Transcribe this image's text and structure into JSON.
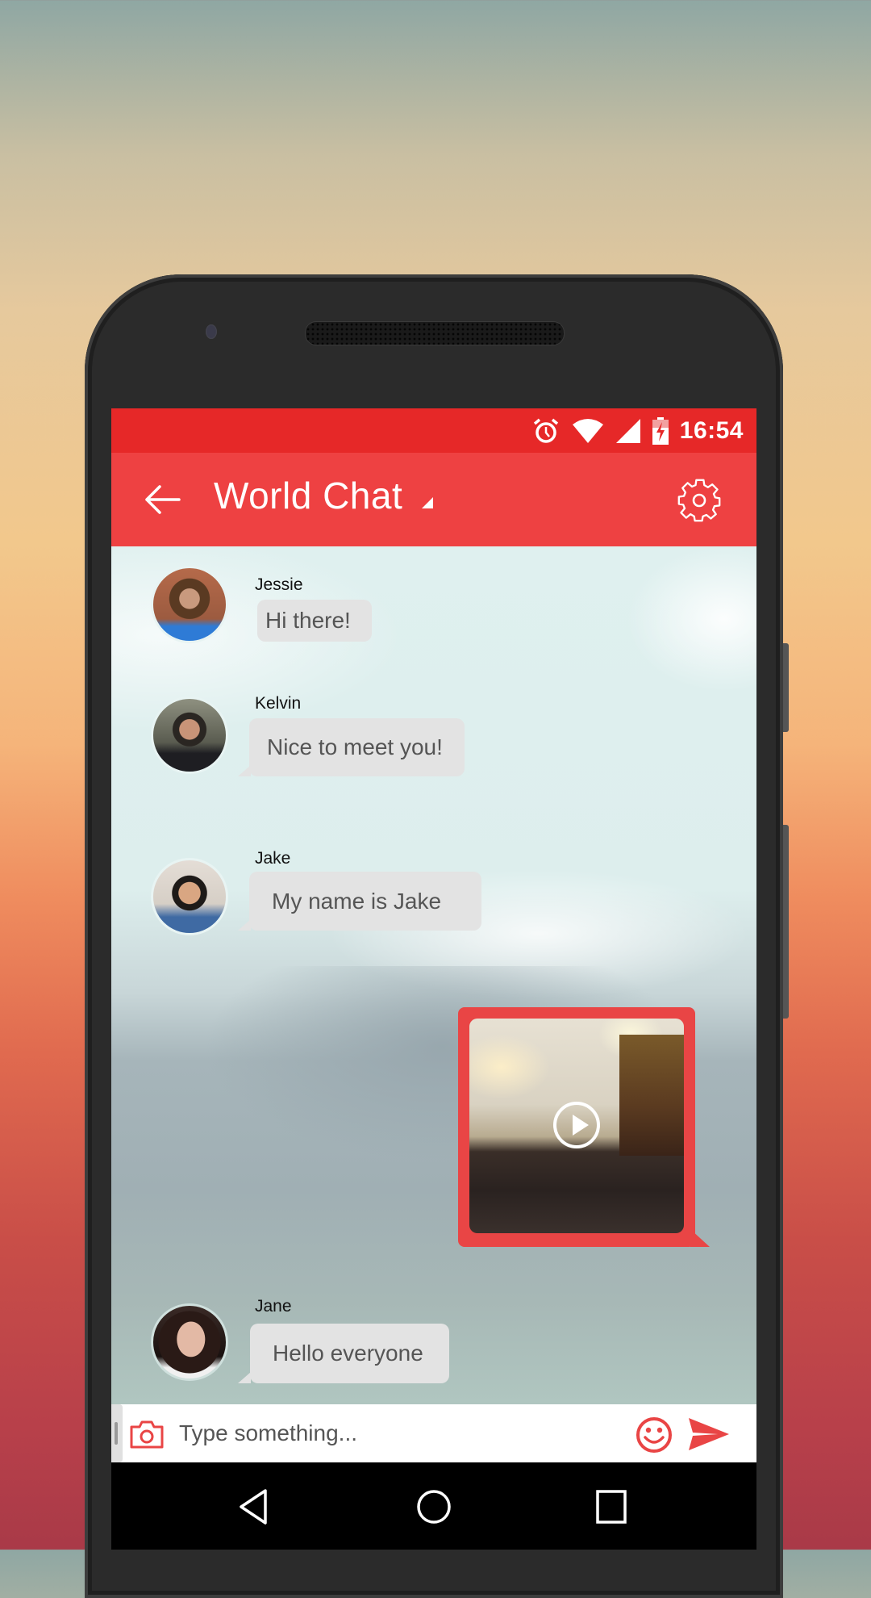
{
  "status_bar": {
    "time": "16:54",
    "icons": [
      "alarm-icon",
      "wifi-icon",
      "signal-icon",
      "battery-charging-icon"
    ]
  },
  "app_bar": {
    "title": "World Chat",
    "back_icon": "arrow-left-icon",
    "dropdown_icon": "caret-down-icon",
    "settings_icon": "gear-icon"
  },
  "messages": [
    {
      "sender": "Jessie",
      "text": "Hi there!",
      "type": "text"
    },
    {
      "sender": "Kelvin",
      "text": "Nice to meet you!",
      "type": "text"
    },
    {
      "sender": "Jake",
      "text": "My name is Jake",
      "type": "text"
    },
    {
      "sender": "me",
      "type": "video",
      "icon": "play-icon"
    },
    {
      "sender": "Jane",
      "text": "Hello everyone",
      "type": "text"
    }
  ],
  "input_bar": {
    "placeholder": "Type something...",
    "value": "",
    "camera_icon": "camera-icon",
    "emoji_icon": "smiley-icon",
    "send_icon": "send-icon"
  },
  "nav_bar": {
    "buttons": [
      "back",
      "home",
      "recents"
    ]
  },
  "colors": {
    "status_bar": "#e62828",
    "app_bar": "#ee4142",
    "accent": "#e94545",
    "bubble": "#e3e3e3"
  }
}
